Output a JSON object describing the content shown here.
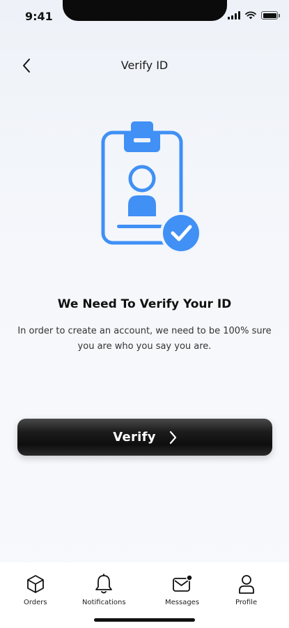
{
  "status_bar": {
    "time": "9:41"
  },
  "header": {
    "title": "Verify ID"
  },
  "main": {
    "headline": "We Need To Verify Your ID",
    "description": "In order to create an account, we need to be 100% sure you are who you say you are.",
    "verify_button_label": "Verify"
  },
  "tab_bar": {
    "items": [
      {
        "label": "Orders",
        "icon": "box-icon"
      },
      {
        "label": "Notifications",
        "icon": "bell-icon"
      },
      {
        "label": "Messages",
        "icon": "envelope-icon"
      },
      {
        "label": "Profile",
        "icon": "user-icon"
      }
    ]
  },
  "colors": {
    "accent": "#4090f5",
    "button_dark": "#111111"
  }
}
